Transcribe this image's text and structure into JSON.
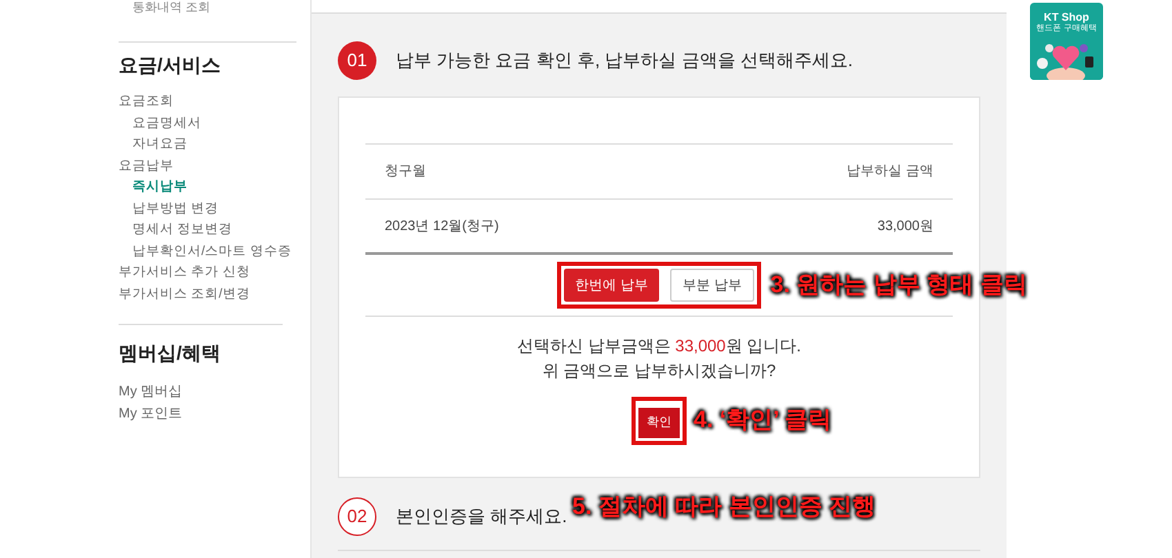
{
  "sidebar": {
    "cut_item": "통화내역 조회",
    "section_title": "요금/서비스",
    "items": [
      {
        "label": "요금조회",
        "selected": false,
        "children": [
          {
            "label": "요금명세서",
            "selected": false
          },
          {
            "label": "자녀요금",
            "selected": false
          }
        ]
      },
      {
        "label": "요금납부",
        "selected": false,
        "children": [
          {
            "label": "즉시납부",
            "selected": true
          },
          {
            "label": "납부방법 변경",
            "selected": false
          },
          {
            "label": "명세서 정보변경",
            "selected": false
          },
          {
            "label": "납부확인서/스마트 영수증",
            "selected": false
          }
        ]
      },
      {
        "label": "부가서비스 추가 신청",
        "selected": false
      },
      {
        "label": "부가서비스 조회/변경",
        "selected": false
      }
    ],
    "section2_title": "멤버십/혜택",
    "section2_items": [
      {
        "label": "My 멤버십",
        "selected": false
      },
      {
        "label": "My 포인트",
        "selected": false
      }
    ]
  },
  "steps": [
    {
      "number": "01",
      "title": "납부 가능한 요금 확인 후, 납부하실 금액을 선택해주세요.",
      "active": true
    },
    {
      "number": "02",
      "title": "본인인증을 해주세요.",
      "active": false
    }
  ],
  "bill_table": {
    "columns": [
      "청구월",
      "납부하실 금액"
    ],
    "rows": [
      [
        "2023년 12월(청구)",
        "33,000원"
      ]
    ]
  },
  "payment_options": [
    {
      "label": "한번에 납부",
      "selected": true
    },
    {
      "label": "부분 납부",
      "selected": false
    }
  ],
  "summary": {
    "before": "선택하신 납부금액은 ",
    "amount": "33,000",
    "after": "원 입니다.",
    "question": "위 금액으로 납부하시겠습니까?"
  },
  "confirm_button": "확인",
  "ad": {
    "title": "KT Shop",
    "subtitle": "핸드폰 구매혜택"
  },
  "annotations": [
    "3. 원하는 납부 형태 클릭",
    "4. ‘확인’ 클릭",
    "5. 절차에 따라 본인인증 진행"
  ]
}
